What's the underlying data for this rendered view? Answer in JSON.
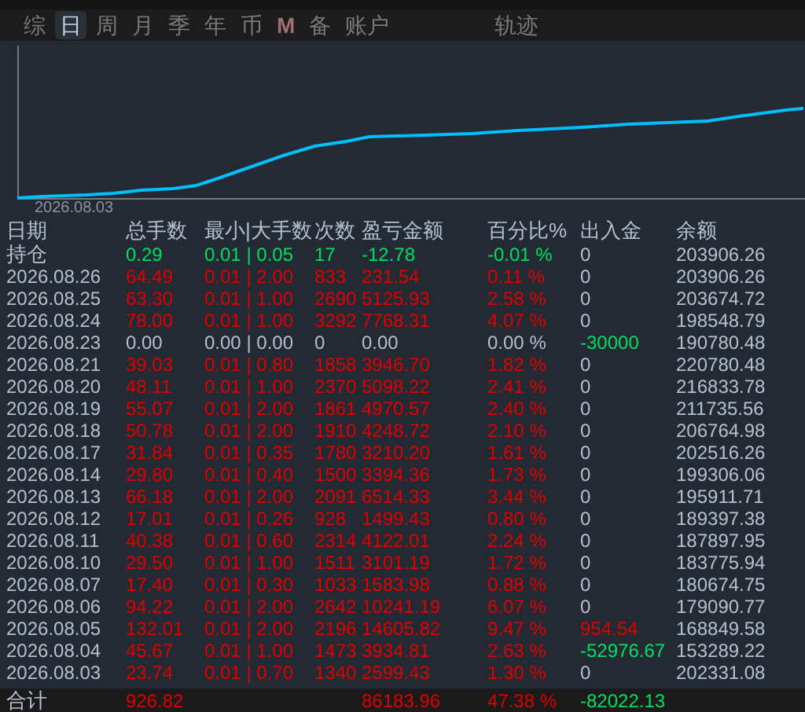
{
  "tabs": [
    {
      "label": "综",
      "kind": "text",
      "selected": false
    },
    {
      "label": "日",
      "kind": "text",
      "selected": true
    },
    {
      "label": "周",
      "kind": "text",
      "selected": false
    },
    {
      "label": "月",
      "kind": "text",
      "selected": false
    },
    {
      "label": "季",
      "kind": "text",
      "selected": false
    },
    {
      "label": "年",
      "kind": "text",
      "selected": false
    },
    {
      "label": "币",
      "kind": "text",
      "selected": false
    },
    {
      "label": "M",
      "kind": "badge",
      "selected": false
    },
    {
      "label": "备",
      "kind": "text",
      "selected": false
    },
    {
      "label": "账户",
      "kind": "text",
      "selected": false
    },
    {
      "label": "轨迹",
      "kind": "far",
      "selected": false
    }
  ],
  "chart": {
    "x_label": "2026.08.03"
  },
  "table": {
    "columns": [
      "日期",
      "总手数",
      "最小|大手数",
      "次数",
      "盈亏金额",
      "百分比%",
      "出入金",
      "余额"
    ],
    "rows": [
      {
        "date": "持仓",
        "lots": "0.29",
        "min_max": "0.01 | 0.05",
        "count": "17",
        "pnl": "-12.78",
        "pct": "-0.01 %",
        "deposit": {
          "text": "0",
          "color": "#b4c0d0"
        },
        "balance": "203906.26",
        "color": "#00e060"
      },
      {
        "date": "2026.08.26",
        "lots": "64.49",
        "min_max": "0.01 | 2.00",
        "count": "833",
        "pnl": "231.54",
        "pct": "0.11 %",
        "deposit": {
          "text": "0",
          "color": "#b4c0d0"
        },
        "balance": "203906.26",
        "color": "#e00000"
      },
      {
        "date": "2026.08.25",
        "lots": "63.30",
        "min_max": "0.01 | 1.00",
        "count": "2690",
        "pnl": "5125.93",
        "pct": "2.58 %",
        "deposit": {
          "text": "0",
          "color": "#b4c0d0"
        },
        "balance": "203674.72",
        "color": "#e00000"
      },
      {
        "date": "2026.08.24",
        "lots": "78.00",
        "min_max": "0.01 | 1.00",
        "count": "3292",
        "pnl": "7768.31",
        "pct": "4.07 %",
        "deposit": {
          "text": "0",
          "color": "#b4c0d0"
        },
        "balance": "198548.79",
        "color": "#e00000"
      },
      {
        "date": "2026.08.23",
        "lots": "0.00",
        "min_max": "0.00 | 0.00",
        "count": "0",
        "pnl": "0.00",
        "pct": "0.00 %",
        "deposit": {
          "text": "-30000",
          "color": "#00e060"
        },
        "balance": "190780.48",
        "color": "#b4c0d0"
      },
      {
        "date": "2026.08.21",
        "lots": "39.03",
        "min_max": "0.01 | 0.80",
        "count": "1858",
        "pnl": "3946.70",
        "pct": "1.82 %",
        "deposit": {
          "text": "0",
          "color": "#b4c0d0"
        },
        "balance": "220780.48",
        "color": "#e00000"
      },
      {
        "date": "2026.08.20",
        "lots": "48.11",
        "min_max": "0.01 | 1.00",
        "count": "2370",
        "pnl": "5098.22",
        "pct": "2.41 %",
        "deposit": {
          "text": "0",
          "color": "#b4c0d0"
        },
        "balance": "216833.78",
        "color": "#e00000"
      },
      {
        "date": "2026.08.19",
        "lots": "55.07",
        "min_max": "0.01 | 2.00",
        "count": "1861",
        "pnl": "4970.57",
        "pct": "2.40 %",
        "deposit": {
          "text": "0",
          "color": "#b4c0d0"
        },
        "balance": "211735.56",
        "color": "#e00000"
      },
      {
        "date": "2026.08.18",
        "lots": "50.78",
        "min_max": "0.01 | 2.00",
        "count": "1910",
        "pnl": "4248.72",
        "pct": "2.10 %",
        "deposit": {
          "text": "0",
          "color": "#b4c0d0"
        },
        "balance": "206764.98",
        "color": "#e00000"
      },
      {
        "date": "2026.08.17",
        "lots": "31.84",
        "min_max": "0.01 | 0.35",
        "count": "1780",
        "pnl": "3210.20",
        "pct": "1.61 %",
        "deposit": {
          "text": "0",
          "color": "#b4c0d0"
        },
        "balance": "202516.26",
        "color": "#e00000"
      },
      {
        "date": "2026.08.14",
        "lots": "29.80",
        "min_max": "0.01 | 0.40",
        "count": "1500",
        "pnl": "3394.36",
        "pct": "1.73 %",
        "deposit": {
          "text": "0",
          "color": "#b4c0d0"
        },
        "balance": "199306.06",
        "color": "#e00000"
      },
      {
        "date": "2026.08.13",
        "lots": "66.18",
        "min_max": "0.01 | 2.00",
        "count": "2091",
        "pnl": "6514.33",
        "pct": "3.44 %",
        "deposit": {
          "text": "0",
          "color": "#b4c0d0"
        },
        "balance": "195911.71",
        "color": "#e00000"
      },
      {
        "date": "2026.08.12",
        "lots": "17.01",
        "min_max": "0.01 | 0.26",
        "count": "928",
        "pnl": "1499.43",
        "pct": "0.80 %",
        "deposit": {
          "text": "0",
          "color": "#b4c0d0"
        },
        "balance": "189397.38",
        "color": "#e00000"
      },
      {
        "date": "2026.08.11",
        "lots": "40.38",
        "min_max": "0.01 | 0.60",
        "count": "2314",
        "pnl": "4122.01",
        "pct": "2.24 %",
        "deposit": {
          "text": "0",
          "color": "#b4c0d0"
        },
        "balance": "187897.95",
        "color": "#e00000"
      },
      {
        "date": "2026.08.10",
        "lots": "29.50",
        "min_max": "0.01 | 1.00",
        "count": "1511",
        "pnl": "3101.19",
        "pct": "1.72 %",
        "deposit": {
          "text": "0",
          "color": "#b4c0d0"
        },
        "balance": "183775.94",
        "color": "#e00000"
      },
      {
        "date": "2026.08.07",
        "lots": "17.40",
        "min_max": "0.01 | 0.30",
        "count": "1033",
        "pnl": "1583.98",
        "pct": "0.88 %",
        "deposit": {
          "text": "0",
          "color": "#b4c0d0"
        },
        "balance": "180674.75",
        "color": "#e00000"
      },
      {
        "date": "2026.08.06",
        "lots": "94.22",
        "min_max": "0.01 | 2.00",
        "count": "2642",
        "pnl": "10241.19",
        "pct": "6.07 %",
        "deposit": {
          "text": "0",
          "color": "#b4c0d0"
        },
        "balance": "179090.77",
        "color": "#e00000"
      },
      {
        "date": "2026.08.05",
        "lots": "132.01",
        "min_max": "0.01 | 2.00",
        "count": "2196",
        "pnl": "14605.82",
        "pct": "9.47 %",
        "deposit": {
          "text": "954.54",
          "color": "#e00000"
        },
        "balance": "168849.58",
        "color": "#e00000"
      },
      {
        "date": "2026.08.04",
        "lots": "45.67",
        "min_max": "0.01 | 1.00",
        "count": "1473",
        "pnl": "3934.81",
        "pct": "2.63 %",
        "deposit": {
          "text": "-52976.67",
          "color": "#00e060"
        },
        "balance": "153289.22",
        "color": "#e00000"
      },
      {
        "date": "2026.08.03",
        "lots": "23.74",
        "min_max": "0.01 | 0.70",
        "count": "1340",
        "pnl": "2599.43",
        "pct": "1.30 %",
        "deposit": {
          "text": "0",
          "color": "#b4c0d0"
        },
        "balance": "202331.08",
        "color": "#e00000"
      }
    ],
    "total": {
      "label": "合计",
      "lots": "926.82",
      "pnl": "86183.96",
      "pct": "47.38 %",
      "deposit": "-82022.13"
    }
  }
}
